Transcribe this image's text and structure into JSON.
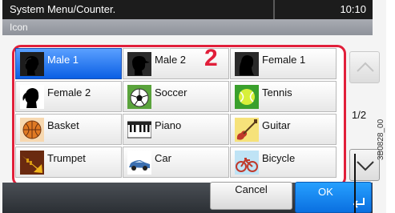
{
  "header": {
    "title": "System Menu/Counter.",
    "time": "10:10"
  },
  "subheader": {
    "label": "Icon"
  },
  "icons": [
    {
      "label": "Male 1",
      "selected": true,
      "icon": "male-silhouette-icon"
    },
    {
      "label": "Male 2",
      "selected": false,
      "icon": "male-cap-silhouette-icon"
    },
    {
      "label": "Female 1",
      "selected": false,
      "icon": "female-silhouette-icon"
    },
    {
      "label": "Female 2",
      "selected": false,
      "icon": "female-ponytail-silhouette-icon"
    },
    {
      "label": "Soccer",
      "selected": false,
      "icon": "soccer-ball-icon"
    },
    {
      "label": "Tennis",
      "selected": false,
      "icon": "tennis-ball-icon"
    },
    {
      "label": "Basket",
      "selected": false,
      "icon": "basketball-icon"
    },
    {
      "label": "Piano",
      "selected": false,
      "icon": "piano-icon"
    },
    {
      "label": "Guitar",
      "selected": false,
      "icon": "guitar-icon"
    },
    {
      "label": "Trumpet",
      "selected": false,
      "icon": "trumpet-icon"
    },
    {
      "label": "Car",
      "selected": false,
      "icon": "car-icon"
    },
    {
      "label": "Bicycle",
      "selected": false,
      "icon": "bicycle-icon"
    }
  ],
  "callout": {
    "number": "2"
  },
  "pagination": {
    "indicator": "1/2"
  },
  "footer": {
    "cancel_label": "Cancel",
    "ok_label": "OK"
  },
  "figure_code": "3B0828_00",
  "colors": {
    "selected": "#1f74f0",
    "accent_red": "#e11f3a",
    "ok_button": "#1a86f5"
  }
}
